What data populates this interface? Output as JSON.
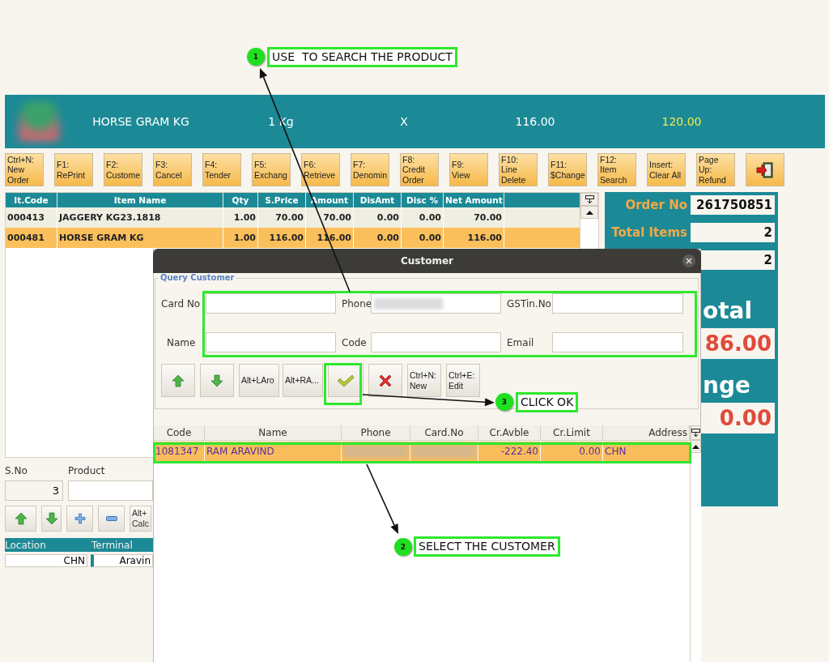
{
  "header": {
    "product": "HORSE GRAM KG",
    "quantity": "1 Kg",
    "separator": "X",
    "price": "116.00",
    "mrp": "120.00"
  },
  "toolbar": [
    {
      "kind": "text",
      "label": "Ctrl+N:\nNew\nOrder"
    },
    {
      "kind": "text",
      "label": "F1:\nRePrint"
    },
    {
      "kind": "text",
      "label": "F2:\nCustome"
    },
    {
      "kind": "text",
      "label": "F3:\nCancel"
    },
    {
      "kind": "text",
      "label": "F4:\nTender"
    },
    {
      "kind": "text",
      "label": "F5:\nExchang"
    },
    {
      "kind": "text",
      "label": "F6:\nRetrieve"
    },
    {
      "kind": "text",
      "label": "F7:\nDenomin"
    },
    {
      "kind": "text",
      "label": "F8:\nCredit\nOrder"
    },
    {
      "kind": "text",
      "label": "F9:\nView"
    },
    {
      "kind": "text",
      "label": "F10:\nLine\nDelete"
    },
    {
      "kind": "text",
      "label": "F11:\n$Change"
    },
    {
      "kind": "text",
      "label": "F12:\nItem\nSearch"
    },
    {
      "kind": "text",
      "label": "Insert:\nClear All"
    },
    {
      "kind": "text",
      "label": "Page\nUp:\nRefund"
    },
    {
      "kind": "exit"
    }
  ],
  "order_table": {
    "columns": [
      "It.Code",
      "Item Name",
      "Qty",
      "S.Price",
      "Amount",
      "DisAmt",
      "Disc %",
      "Net Amount"
    ],
    "rows": [
      {
        "cells": [
          "000413",
          "JAGGERY KG23.1818",
          "1.00",
          "70.00",
          "70.00",
          "0.00",
          "0.00",
          "70.00"
        ],
        "selected": false
      },
      {
        "cells": [
          "000481",
          "HORSE GRAM KG",
          "1.00",
          "116.00",
          "116.00",
          "0.00",
          "0.00",
          "116.00"
        ],
        "selected": true
      }
    ]
  },
  "summary": {
    "order_no_label": "Order No",
    "order_no": "261750851",
    "total_items_label": "Total Items",
    "total_items": "2",
    "row_3_value": "2",
    "total_label": "otal",
    "total": "86.00",
    "change_label": "nge",
    "change": "0.00"
  },
  "entry": {
    "sno_label": "S.No",
    "product_label": "Product",
    "sno": "3",
    "buttons": [
      {
        "kind": "up"
      },
      {
        "kind": "down"
      },
      {
        "kind": "plus"
      },
      {
        "kind": "minus"
      },
      {
        "kind": "text",
        "label": "Alt+\nCalc"
      }
    ]
  },
  "info": {
    "columns": [
      "Location",
      "Terminal"
    ],
    "values": [
      "CHN",
      "Aravin"
    ]
  },
  "dialog": {
    "title": "Customer",
    "group_title": "Query Customer",
    "fields": [
      {
        "label": "Card No",
        "blurred": false
      },
      {
        "label": "Phone",
        "blurred": true
      },
      {
        "label": "GSTin.No",
        "blurred": false
      },
      {
        "label": "Name",
        "blurred": false
      },
      {
        "label": "Code",
        "blurred": false
      },
      {
        "label": "Email",
        "blurred": false
      }
    ],
    "buttons": [
      {
        "kind": "up"
      },
      {
        "kind": "down"
      },
      {
        "kind": "text",
        "label": "Alt+LAro"
      },
      {
        "kind": "text",
        "label": "Alt+RA..."
      },
      {
        "kind": "ok"
      },
      {
        "kind": "cancel"
      },
      {
        "kind": "text",
        "label": "Ctrl+N:\nNew"
      },
      {
        "kind": "text",
        "label": "Ctrl+E:\nEdit"
      }
    ],
    "table": {
      "columns": [
        "Code",
        "Name",
        "Phone",
        "Card.No",
        "Cr.Avble",
        "Cr.Limit",
        "Address"
      ],
      "rows": [
        {
          "cells": [
            "1081347",
            "RAM ARAVIND",
            null,
            null,
            "-222.40",
            "0.00",
            "CHN"
          ],
          "selected": true
        }
      ]
    }
  },
  "annotations": [
    {
      "number": "1",
      "text": "USE  TO SEARCH THE PRODUCT"
    },
    {
      "number": "3",
      "text": "CLICK OK"
    },
    {
      "number": "2",
      "text": "SELECT THE CUSTOMER"
    }
  ]
}
